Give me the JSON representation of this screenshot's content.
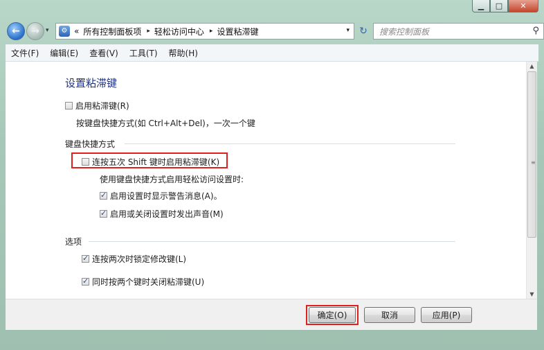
{
  "window": {
    "controls": {
      "minimize": "▁",
      "maximize": "□",
      "close": "✕"
    }
  },
  "nav": {
    "back_glyph": "←",
    "forward_glyph": "→",
    "history_glyph": "▾",
    "breadcrumb": {
      "overflow": "«",
      "items": [
        "所有控制面板项",
        "轻松访问中心",
        "设置粘滞键"
      ],
      "separator": "▸"
    },
    "address_drop_glyph": "▾",
    "refresh_glyph": "↻",
    "search": {
      "placeholder": "搜索控制面板",
      "icon_glyph": "⚲"
    }
  },
  "menu": [
    "文件(F)",
    "编辑(E)",
    "查看(V)",
    "工具(T)",
    "帮助(H)"
  ],
  "content": {
    "title": "设置粘滞键",
    "enable_sticky": {
      "label": "启用粘滞键(R)",
      "checked": false
    },
    "description": "按键盘快捷方式(如 Ctrl+Alt+Del)，一次一个键",
    "section_shortcut": "键盘快捷方式",
    "shift5": {
      "label": "连按五次 Shift 键时启用粘滞键(K)",
      "checked": false
    },
    "when_using": "使用键盘快捷方式启用轻松访问设置时:",
    "warn": {
      "label": "启用设置时显示警告消息(A)。",
      "checked": true
    },
    "sound": {
      "label": "启用或关闭设置时发出声音(M)",
      "checked": true
    },
    "section_options": "选项",
    "lock": {
      "label": "连按两次时锁定修改键(L)",
      "checked": true
    },
    "twokeys": {
      "label": "同时按两个键时关闭粘滞键(U)",
      "checked": true
    }
  },
  "footer": {
    "ok": "确定(O)",
    "cancel": "取消",
    "apply": "应用(P)"
  },
  "colors": {
    "highlight": "#e0201c",
    "title": "#1e3287"
  }
}
